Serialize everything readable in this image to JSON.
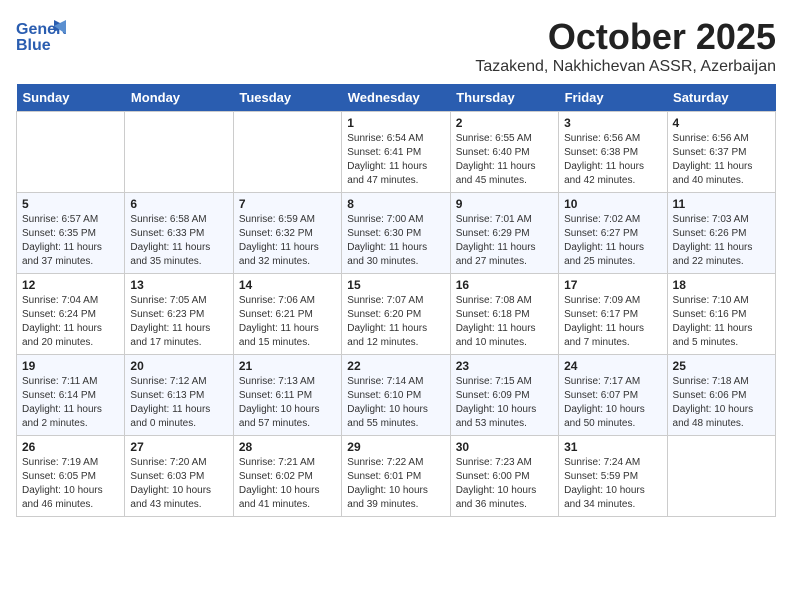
{
  "logo": {
    "line1": "General",
    "line2": "Blue"
  },
  "title": "October 2025",
  "location": "Tazakend, Nakhichevan ASSR, Azerbaijan",
  "weekdays": [
    "Sunday",
    "Monday",
    "Tuesday",
    "Wednesday",
    "Thursday",
    "Friday",
    "Saturday"
  ],
  "weeks": [
    [
      {
        "day": "",
        "info": ""
      },
      {
        "day": "",
        "info": ""
      },
      {
        "day": "",
        "info": ""
      },
      {
        "day": "1",
        "info": "Sunrise: 6:54 AM\nSunset: 6:41 PM\nDaylight: 11 hours and 47 minutes."
      },
      {
        "day": "2",
        "info": "Sunrise: 6:55 AM\nSunset: 6:40 PM\nDaylight: 11 hours and 45 minutes."
      },
      {
        "day": "3",
        "info": "Sunrise: 6:56 AM\nSunset: 6:38 PM\nDaylight: 11 hours and 42 minutes."
      },
      {
        "day": "4",
        "info": "Sunrise: 6:56 AM\nSunset: 6:37 PM\nDaylight: 11 hours and 40 minutes."
      }
    ],
    [
      {
        "day": "5",
        "info": "Sunrise: 6:57 AM\nSunset: 6:35 PM\nDaylight: 11 hours and 37 minutes."
      },
      {
        "day": "6",
        "info": "Sunrise: 6:58 AM\nSunset: 6:33 PM\nDaylight: 11 hours and 35 minutes."
      },
      {
        "day": "7",
        "info": "Sunrise: 6:59 AM\nSunset: 6:32 PM\nDaylight: 11 hours and 32 minutes."
      },
      {
        "day": "8",
        "info": "Sunrise: 7:00 AM\nSunset: 6:30 PM\nDaylight: 11 hours and 30 minutes."
      },
      {
        "day": "9",
        "info": "Sunrise: 7:01 AM\nSunset: 6:29 PM\nDaylight: 11 hours and 27 minutes."
      },
      {
        "day": "10",
        "info": "Sunrise: 7:02 AM\nSunset: 6:27 PM\nDaylight: 11 hours and 25 minutes."
      },
      {
        "day": "11",
        "info": "Sunrise: 7:03 AM\nSunset: 6:26 PM\nDaylight: 11 hours and 22 minutes."
      }
    ],
    [
      {
        "day": "12",
        "info": "Sunrise: 7:04 AM\nSunset: 6:24 PM\nDaylight: 11 hours and 20 minutes."
      },
      {
        "day": "13",
        "info": "Sunrise: 7:05 AM\nSunset: 6:23 PM\nDaylight: 11 hours and 17 minutes."
      },
      {
        "day": "14",
        "info": "Sunrise: 7:06 AM\nSunset: 6:21 PM\nDaylight: 11 hours and 15 minutes."
      },
      {
        "day": "15",
        "info": "Sunrise: 7:07 AM\nSunset: 6:20 PM\nDaylight: 11 hours and 12 minutes."
      },
      {
        "day": "16",
        "info": "Sunrise: 7:08 AM\nSunset: 6:18 PM\nDaylight: 11 hours and 10 minutes."
      },
      {
        "day": "17",
        "info": "Sunrise: 7:09 AM\nSunset: 6:17 PM\nDaylight: 11 hours and 7 minutes."
      },
      {
        "day": "18",
        "info": "Sunrise: 7:10 AM\nSunset: 6:16 PM\nDaylight: 11 hours and 5 minutes."
      }
    ],
    [
      {
        "day": "19",
        "info": "Sunrise: 7:11 AM\nSunset: 6:14 PM\nDaylight: 11 hours and 2 minutes."
      },
      {
        "day": "20",
        "info": "Sunrise: 7:12 AM\nSunset: 6:13 PM\nDaylight: 11 hours and 0 minutes."
      },
      {
        "day": "21",
        "info": "Sunrise: 7:13 AM\nSunset: 6:11 PM\nDaylight: 10 hours and 57 minutes."
      },
      {
        "day": "22",
        "info": "Sunrise: 7:14 AM\nSunset: 6:10 PM\nDaylight: 10 hours and 55 minutes."
      },
      {
        "day": "23",
        "info": "Sunrise: 7:15 AM\nSunset: 6:09 PM\nDaylight: 10 hours and 53 minutes."
      },
      {
        "day": "24",
        "info": "Sunrise: 7:17 AM\nSunset: 6:07 PM\nDaylight: 10 hours and 50 minutes."
      },
      {
        "day": "25",
        "info": "Sunrise: 7:18 AM\nSunset: 6:06 PM\nDaylight: 10 hours and 48 minutes."
      }
    ],
    [
      {
        "day": "26",
        "info": "Sunrise: 7:19 AM\nSunset: 6:05 PM\nDaylight: 10 hours and 46 minutes."
      },
      {
        "day": "27",
        "info": "Sunrise: 7:20 AM\nSunset: 6:03 PM\nDaylight: 10 hours and 43 minutes."
      },
      {
        "day": "28",
        "info": "Sunrise: 7:21 AM\nSunset: 6:02 PM\nDaylight: 10 hours and 41 minutes."
      },
      {
        "day": "29",
        "info": "Sunrise: 7:22 AM\nSunset: 6:01 PM\nDaylight: 10 hours and 39 minutes."
      },
      {
        "day": "30",
        "info": "Sunrise: 7:23 AM\nSunset: 6:00 PM\nDaylight: 10 hours and 36 minutes."
      },
      {
        "day": "31",
        "info": "Sunrise: 7:24 AM\nSunset: 5:59 PM\nDaylight: 10 hours and 34 minutes."
      },
      {
        "day": "",
        "info": ""
      }
    ]
  ]
}
